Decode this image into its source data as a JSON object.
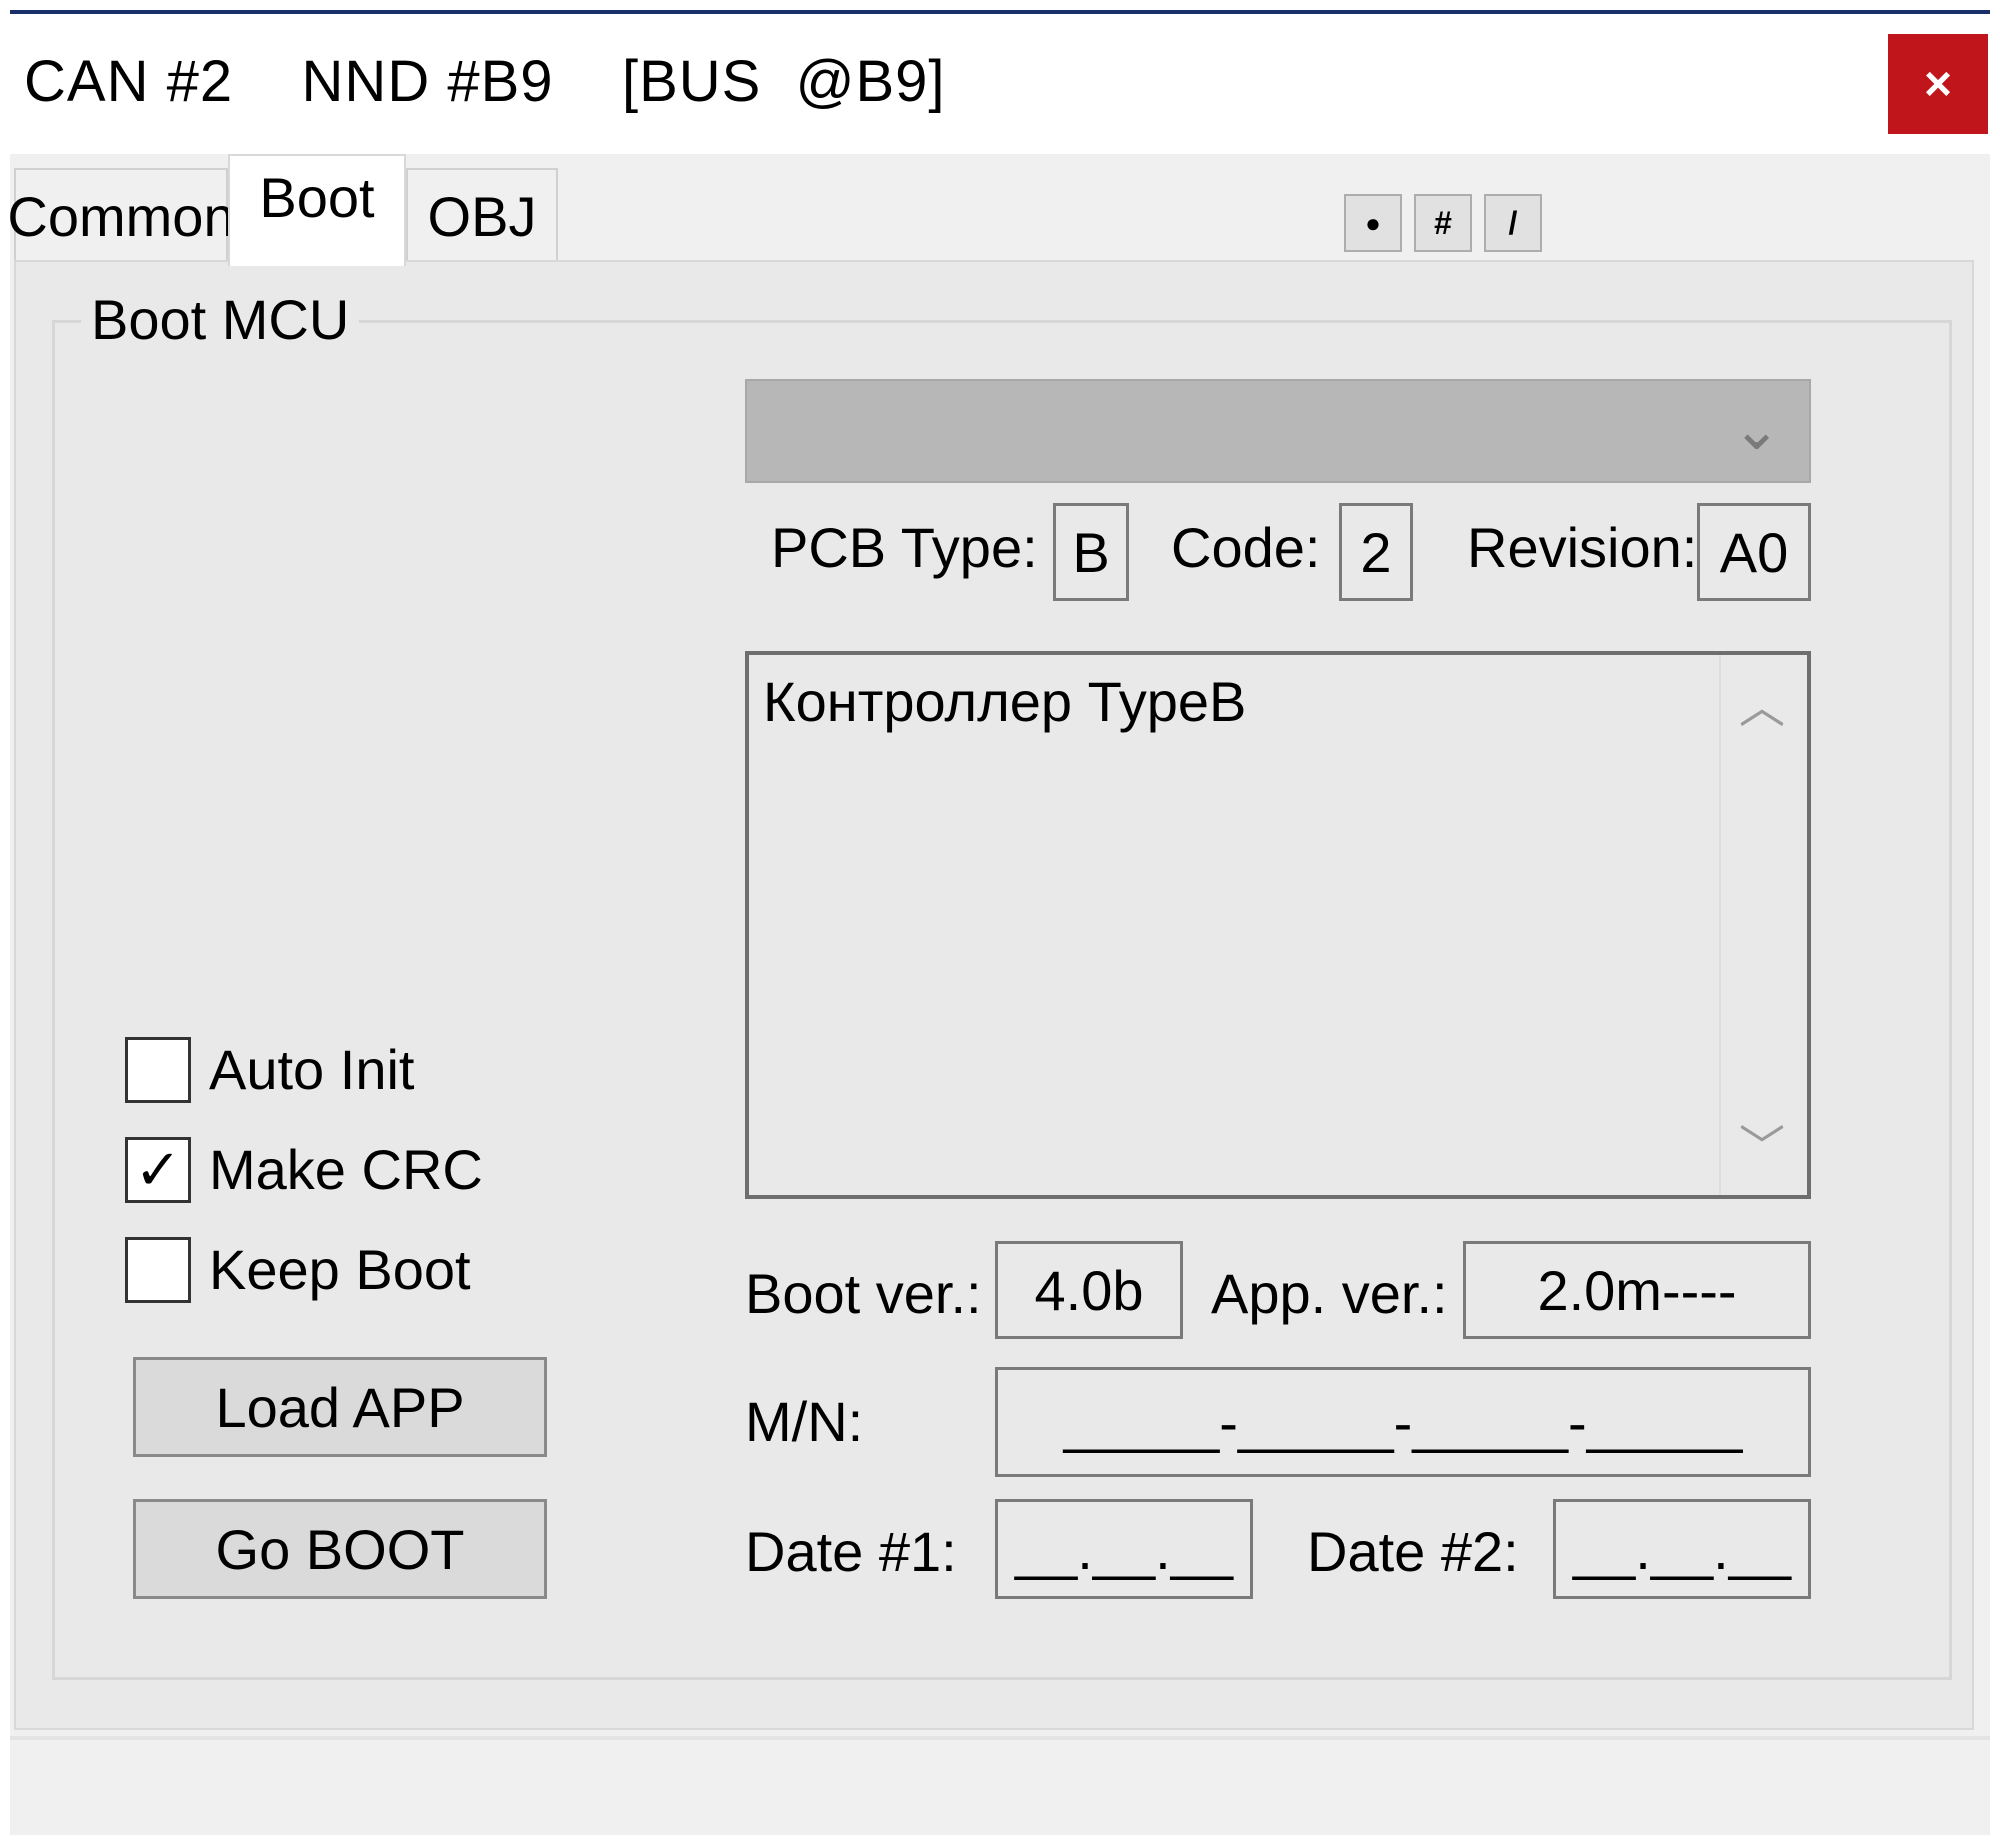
{
  "window": {
    "title": "CAN #2    NND #B9    [BUS  @B9]",
    "close_glyph": "×"
  },
  "tabs": [
    {
      "label": "Common"
    },
    {
      "label": "Boot"
    },
    {
      "label": "OBJ"
    }
  ],
  "toolbar": {
    "btn_dot": "●",
    "btn_hash": "#",
    "btn_slash": "/"
  },
  "boot_group": {
    "title": "Boot MCU",
    "combo_value": "",
    "pcb_type_label": "PCB Type:",
    "pcb_type_value": "B",
    "code_label": "Code:",
    "code_value": "2",
    "revision_label": "Revision:",
    "revision_value": "A0",
    "description": "Контроллер TypeB",
    "boot_ver_label": "Boot ver.:",
    "boot_ver_value": "4.0b",
    "app_ver_label": "App. ver.:",
    "app_ver_value": "2.0m----",
    "mn_label": "M/N:",
    "mn_value": "_____-_____-_____-_____",
    "date1_label": "Date #1:",
    "date1_value": "__.__.__",
    "date2_label": "Date #2:",
    "date2_value": "__.__.__",
    "checkboxes": [
      {
        "label": "Auto Init",
        "checked": false,
        "mark": ""
      },
      {
        "label": "Make CRC",
        "checked": true,
        "mark": "✓"
      },
      {
        "label": "Keep Boot",
        "checked": false,
        "mark": ""
      }
    ],
    "load_app_label": "Load APP",
    "go_boot_label": "Go BOOT"
  },
  "icons": {
    "combo_arrow": "chevron-down-icon",
    "scroll_up": "chevron-up-icon",
    "scroll_down": "chevron-down-icon",
    "close": "close-icon"
  },
  "colors": {
    "close_bg": "#c0151b",
    "title_border": "#1a2f6b"
  }
}
